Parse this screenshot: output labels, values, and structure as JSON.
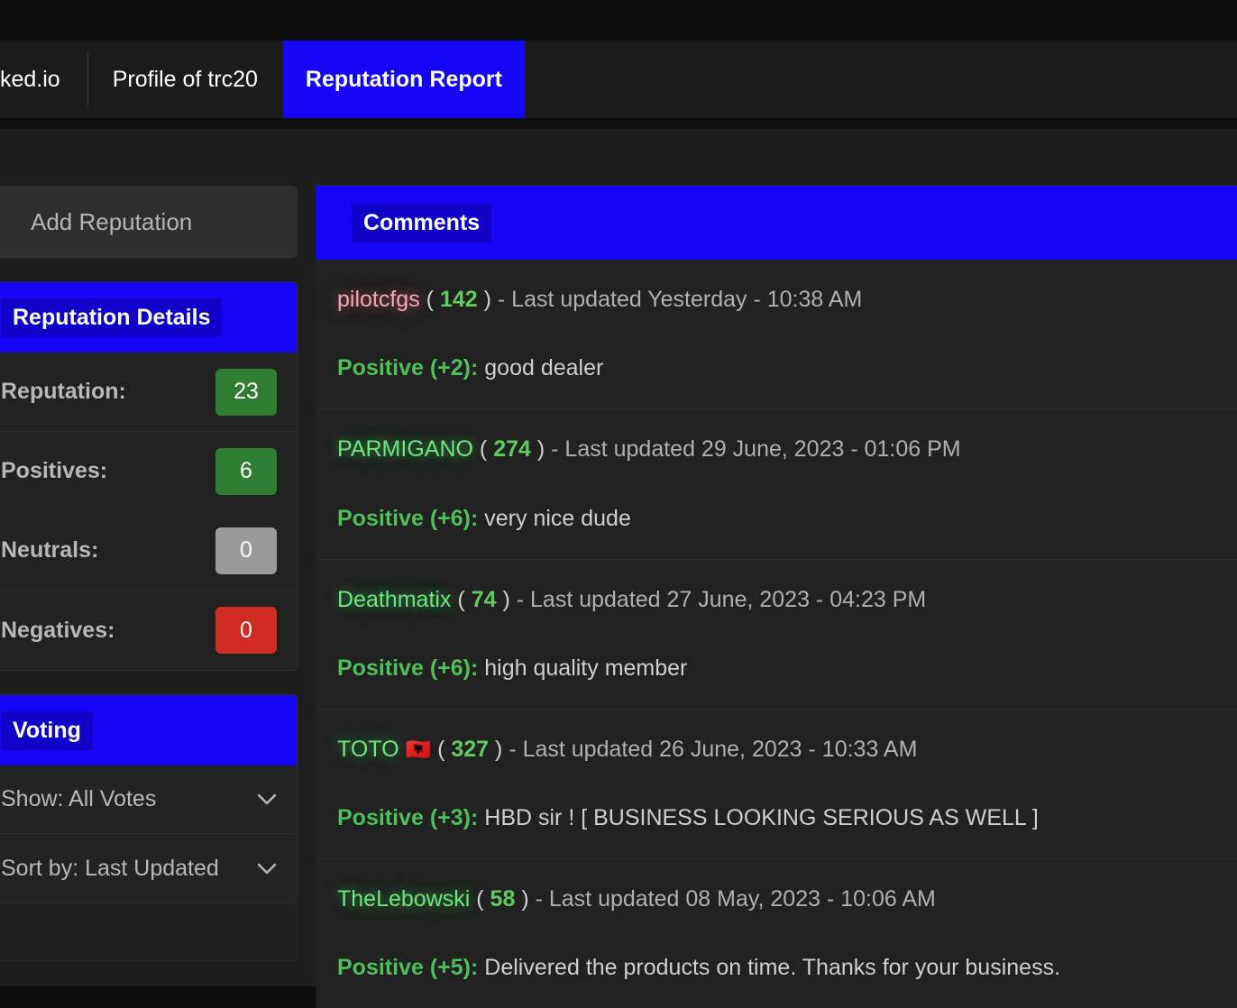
{
  "browser": {
    "tabs": [
      {
        "label": "ked.io",
        "active": false,
        "partial": true
      },
      {
        "label": "Profile of trc20",
        "active": false,
        "partial": false
      },
      {
        "label": "Reputation Report",
        "active": true,
        "partial": false
      }
    ]
  },
  "colors": {
    "accent_blue": "#1405f5",
    "accent_blue_dark": "#1002c9",
    "green_badge": "#2e7d32",
    "grey_badge": "#9a9a9a",
    "red_badge": "#cf2b22",
    "username_green": "#6ee77f",
    "username_pink": "#f0a8b4",
    "verdict_green": "#4fbf57",
    "page_bg": "#1d1d1d",
    "panel_bg": "#212121"
  },
  "sidebar": {
    "add_reputation_label": "Add Reputation",
    "details_panel": {
      "title": "Reputation Details",
      "rows": [
        {
          "label": "Reputation:",
          "value": "23",
          "tone": "green"
        },
        {
          "label": "Positives:",
          "value": "6",
          "tone": "green"
        },
        {
          "label": "Neutrals:",
          "value": "0",
          "tone": "grey"
        },
        {
          "label": "Negatives:",
          "value": "0",
          "tone": "red"
        }
      ]
    },
    "voting_panel": {
      "title": "Voting",
      "selects": [
        {
          "value": "Show: All Votes",
          "icon": "chevron-down-icon"
        },
        {
          "value": "Sort by: Last Updated",
          "icon": "chevron-down-icon"
        }
      ]
    }
  },
  "comments": {
    "title": "Comments",
    "items": [
      {
        "username": "pilotcfgs",
        "username_tone": "pink",
        "flag": "",
        "rep": "142",
        "meta_tail": "- Last updated Yesterday - 10:38 AM",
        "verdict": "Positive (+2):",
        "text": "good dealer"
      },
      {
        "username": "PARMIGANO",
        "username_tone": "green",
        "flag": "",
        "rep": "274",
        "meta_tail": "- Last updated 29 June, 2023 - 01:06 PM",
        "verdict": "Positive (+6):",
        "text": "very nice dude"
      },
      {
        "username": "Deathmatix",
        "username_tone": "green",
        "flag": "",
        "rep": "74",
        "meta_tail": "- Last updated 27 June, 2023 - 04:23 PM",
        "verdict": "Positive (+6):",
        "text": "high quality member"
      },
      {
        "username": "TOTO",
        "username_tone": "green",
        "flag": "🇦🇱",
        "rep": "327",
        "meta_tail": "- Last updated 26 June, 2023 - 10:33 AM",
        "verdict": "Positive (+3):",
        "text": "HBD sir ! [ BUSINESS LOOKING SERIOUS AS WELL ]"
      },
      {
        "username": "TheLebowski",
        "username_tone": "green",
        "flag": "",
        "rep": "58",
        "meta_tail": "- Last updated 08 May, 2023 - 10:06 AM",
        "verdict": "Positive (+5):",
        "text": "Delivered the products on time. Thanks for your business."
      }
    ]
  }
}
